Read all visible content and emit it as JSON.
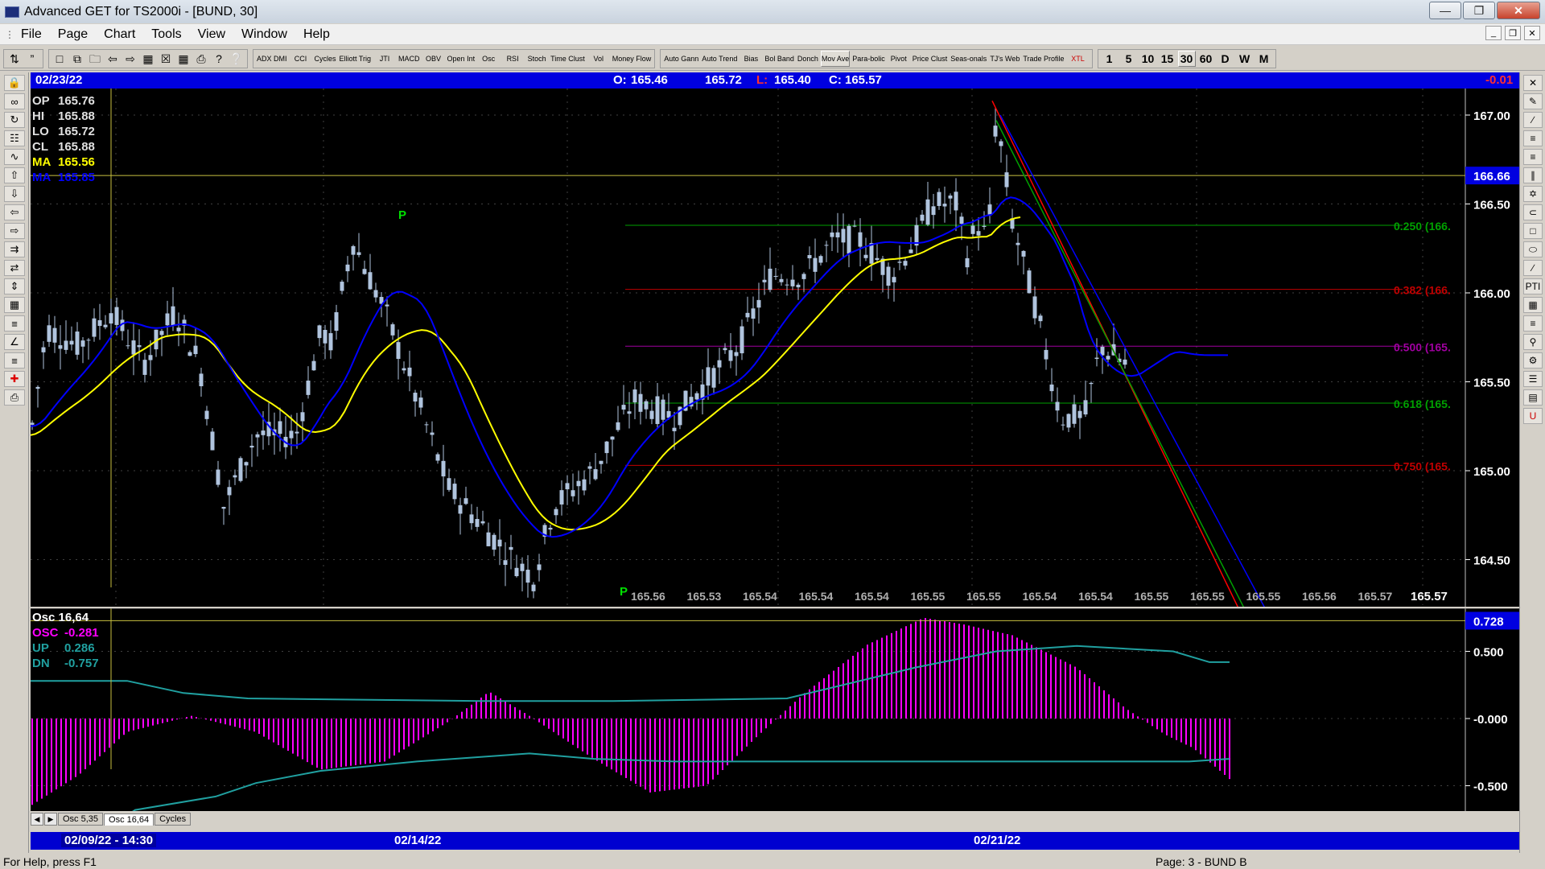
{
  "window": {
    "title": "Advanced GET for TS2000i - [BUND, 30]",
    "min_icon": "minimize-icon",
    "max_icon": "maximize-icon",
    "close_icon": "close-icon"
  },
  "menu": [
    "File",
    "Page",
    "Chart",
    "Tools",
    "View",
    "Window",
    "Help"
  ],
  "toolbar": {
    "studies": [
      "ADX DMI",
      "CCI",
      "Cycles",
      "Elliott Trig",
      "JTI",
      "MACD",
      "OBV",
      "Open Int",
      "Osc",
      "RSI",
      "Stoch",
      "Time Clust",
      "Vol",
      "Money Flow"
    ],
    "studies2": [
      "Auto Gann",
      "Auto Trend",
      "Bias",
      "Bol Band",
      "Donch",
      "Mov Ave",
      "Para-bolic",
      "Pivot",
      "Price Clust",
      "Seas-onals",
      "TJ's Web",
      "Trade Profile",
      "XTL"
    ],
    "selected_study": "Mov Ave",
    "intervals": [
      "1",
      "5",
      "10",
      "15",
      "30",
      "60",
      "D",
      "W",
      "M"
    ],
    "selected_interval": "30"
  },
  "datebar": {
    "date": "02/23/22",
    "o_label": "O:",
    "o": "165.46",
    "h": "165.72",
    "l_label": "L:",
    "l": "165.40",
    "c_label": "C:",
    "c": "165.57",
    "change": "-0.01"
  },
  "legend": {
    "op_label": "OP",
    "op": "165.76",
    "hi_label": "HI",
    "hi": "165.88",
    "lo_label": "LO",
    "lo": "165.72",
    "cl_label": "CL",
    "cl": "165.88",
    "ma1_label": "MA",
    "ma1": "165.56",
    "ma2_label": "MA",
    "ma2": "165.85"
  },
  "chart_data": [
    {
      "type": "candlestick",
      "title": "BUND, 30",
      "y_ticks": [
        "167.00",
        "166.50",
        "166.00",
        "165.50",
        "165.00",
        "164.50"
      ],
      "ylim": [
        164.2,
        167.1
      ],
      "crosshair_price": "166.66",
      "fib_levels": [
        {
          "label": "0.250 (166.",
          "value": 166.38,
          "color": "#00a000"
        },
        {
          "label": "0.382 (166.",
          "value": 166.02,
          "color": "#c00000"
        },
        {
          "label": "0.500 (165.",
          "value": 165.7,
          "color": "#a000a0"
        },
        {
          "label": "0.618 (165.",
          "value": 165.38,
          "color": "#00a000"
        },
        {
          "label": "0.750 (165.",
          "value": 165.03,
          "color": "#c00000"
        }
      ],
      "pivot_labels": [
        "P",
        "P"
      ],
      "forecast_values": [
        "165.56",
        "165.53",
        "165.54",
        "165.54",
        "165.54",
        "165.55",
        "165.55",
        "165.54",
        "165.54",
        "165.55",
        "165.55",
        "165.55",
        "165.56",
        "165.57"
      ],
      "last_price": "165.57",
      "series": [
        {
          "name": "MA",
          "color": "#ffff00"
        },
        {
          "name": "MA",
          "color": "#0000ff"
        }
      ]
    },
    {
      "type": "bar",
      "title": "Osc 16,64",
      "y_ticks": [
        "0.500",
        "-0.000",
        "-0.500"
      ],
      "ylim": [
        -0.8,
        0.78
      ],
      "current": "0.728",
      "osc_label": "OSC",
      "osc": "-0.281",
      "up_label": "UP",
      "up": "0.286",
      "dn_label": "DN",
      "dn": "-0.757",
      "colors": {
        "osc": "#ff00ff",
        "bands": "#20a0a0"
      }
    }
  ],
  "tabs": [
    "Osc 5,35",
    "Osc 16,64",
    "Cycles"
  ],
  "active_tab": "Osc 16,64",
  "timeaxis": {
    "cursor": "02/09/22 - 14:30",
    "d1": "02/14/22",
    "d2": "02/21/22"
  },
  "status": {
    "help": "For Help, press F1",
    "page": "Page: 3 - BUND B"
  }
}
